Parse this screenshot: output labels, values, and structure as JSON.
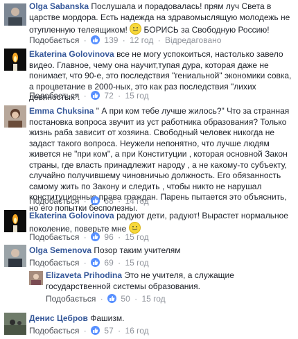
{
  "common": {
    "like_label": "Подобається",
    "dot": "·"
  },
  "comments": [
    {
      "author": "Olga Sabanska",
      "text": "Послушала и порадовалась! прям луч Света в царстве мордора. Есть надежда на здравомыслящую молодежь не отупленную телеящиком!",
      "text_after_emoji": "БОРИСЬ за Свободную Россию!",
      "likes": "139",
      "time": "12 год",
      "edited": "Відредаговано",
      "avatar_icon": "photo-avatar"
    },
    {
      "author": "Ekaterina Golovinova",
      "text": "все не могу успокоиться, настолько завело видео. Главное, чему она научит,тупая дура, которая даже не понимает, что 90-е, это последствия \"гениальной\" экономики совка, а процветание в 2000-ных, это как раз последствия \"лихих девяностых\".",
      "likes": "72",
      "time": "15 год",
      "avatar_icon": "candle-avatar"
    },
    {
      "author": "Emma Chuksina",
      "text": "\" А при ком тебе лучше жилось?\" Что за странная постановка вопроса звучит из уст работника образования? Только жизнь раба зависит от хозяина. Свободный человек никогда не задаст такого вопроса. Неужели непонятно, что лучше людям живется не \"при ком\", а при Конституции , которая основной Закон страны, где власть принадлежит народу , а не какому-то субъекту, случайно получившему чиновничью должность. Его обязанность самому жить по Закону и следить , чтобы никто не нарушал конституционные права граждан. Парень пытается это объяснить, но его попытки бесполезны.",
      "likes": "68",
      "time": "14 год",
      "avatar_icon": "photo-avatar"
    },
    {
      "author": "Ekaterina Golovinova",
      "text": "радуют дети, радуют! Вырастет нормальное поколение, поверьте мне",
      "likes": "96",
      "time": "15 год",
      "avatar_icon": "candle-avatar"
    },
    {
      "author": "Olga Semenova",
      "text": "Позор таким учителям",
      "likes": "69",
      "time": "15 год",
      "avatar_icon": "photo-avatar"
    },
    {
      "author": "Elizaveta Prihodina",
      "text": "Это не учителя, а служащие государственной системы образования.",
      "likes": "50",
      "time": "15 год",
      "avatar_icon": "photo-avatar"
    },
    {
      "author": "Денис Цебров",
      "text": "Фашизм.",
      "likes": "57",
      "time": "16 год",
      "avatar_icon": "photo-avatar"
    }
  ]
}
